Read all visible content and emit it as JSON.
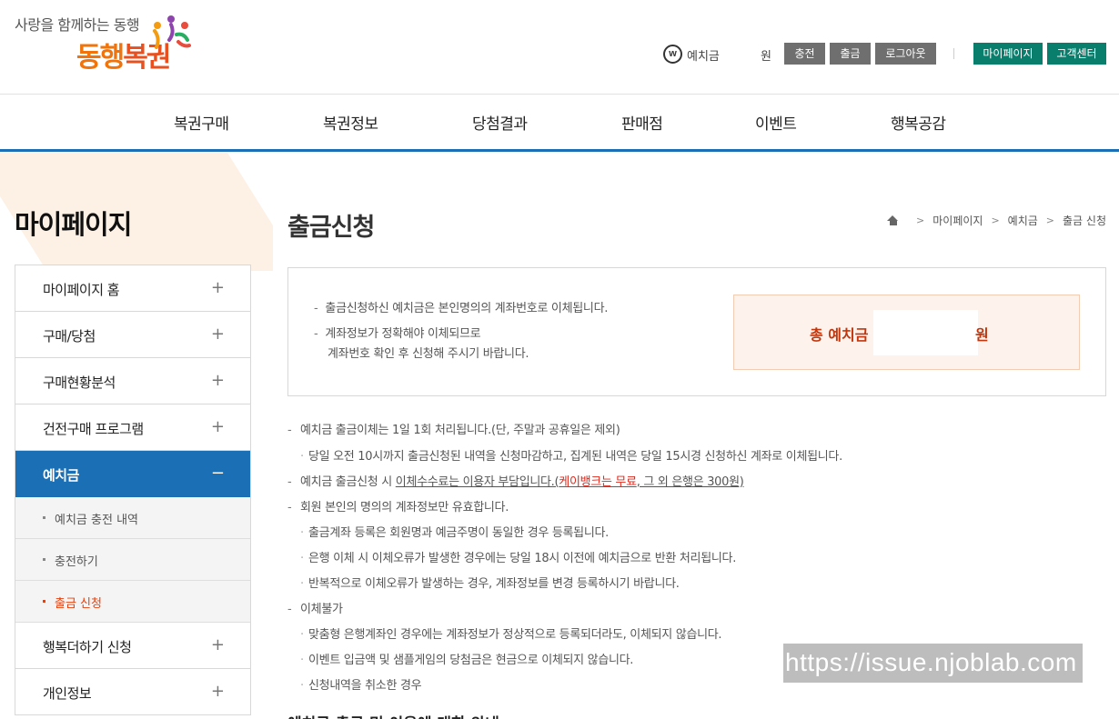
{
  "header": {
    "tagline": "사랑을 함께하는 동행",
    "logo_text_a": "동행",
    "logo_text_b": "복권",
    "w_icon_letter": "w",
    "deposit_label": "예치금",
    "won_label": "원",
    "buttons": {
      "charge": "충전",
      "withdraw": "출금",
      "logout": "로그아웃",
      "mypage": "마이페이지",
      "support": "고객센터"
    }
  },
  "gnb": [
    "복권구매",
    "복권정보",
    "당첨결과",
    "판매점",
    "이벤트",
    "행복공감"
  ],
  "sidebar": {
    "title": "마이페이지",
    "items": [
      {
        "label": "마이페이지 홈",
        "icon": "+"
      },
      {
        "label": "구매/당첨",
        "icon": "+"
      },
      {
        "label": "구매현황분석",
        "icon": "+"
      },
      {
        "label": "건전구매 프로그램",
        "icon": "+"
      },
      {
        "label": "예치금",
        "icon": "−"
      },
      {
        "label": "행복더하기 신청",
        "icon": "+"
      },
      {
        "label": "개인정보",
        "icon": "+"
      }
    ],
    "sub_items": [
      {
        "label": "예치금 충전 내역"
      },
      {
        "label": "충전하기"
      },
      {
        "label": "출금 신청"
      }
    ]
  },
  "main": {
    "title": "출금신청",
    "breadcrumb": [
      "마이페이지",
      "예치금",
      "출금 신청"
    ],
    "info": {
      "line1": "출금신청하신 예치금은 본인명의의 계좌번호로 이체됩니다.",
      "line2a": "계좌정보가 정확해야 이체되므로",
      "line2b": "계좌번호 확인 후 신청해 주시기 바랍니다."
    },
    "total": {
      "label": "총 예치금",
      "unit": "원"
    },
    "notes": {
      "n1": "예치금 출금이체는 1일 1회 처리됩니다.(단, 주말과 공휴일은 제외)",
      "n1s": "당일 오전 10시까지 출금신청된 내역을 신청마감하고, 집계된 내역은 당일 15시경 신청하신 계좌로 이체됩니다.",
      "n2a": "예치금 출금신청 시 ",
      "n2b": "이체수수료는 이용자 부담입니다.(",
      "n2c": "케이뱅크는 무료",
      "n2d": ", 그 외 은행은 300원)",
      "n3": "회원 본인의 명의의 계좌정보만 유효합니다.",
      "n3s1": "출금계좌 등록은 회원명과 예금주명이 동일한 경우 등록됩니다.",
      "n3s2": "은행 이체 시 이체오류가 발생한 경우에는 당일 18시 이전에 예치금으로 반환 처리됩니다.",
      "n3s3": "반복적으로 이체오류가 발생하는 경우, 계좌정보를 변경 등록하시기 바랍니다.",
      "n4": "이체불가",
      "n4s1": "맞춤형 은행계좌인 경우에는 계좌정보가 정상적으로 등록되더라도, 이체되지 않습니다.",
      "n4s2": "이벤트 입금액 및 샘플게임의 당첨금은 현금으로 이체되지 않습니다.",
      "n4s3": "신청내역을 취소한 경우"
    },
    "next_heading": "예치금 출금 및 이용에 대한 안내"
  },
  "watermark": "https://issue.njoblab.com",
  "colors": {
    "accent_blue": "#1a6fb5",
    "brand_orange": "#f0730b",
    "teal": "#0a7e6c",
    "red": "#e0281b"
  }
}
